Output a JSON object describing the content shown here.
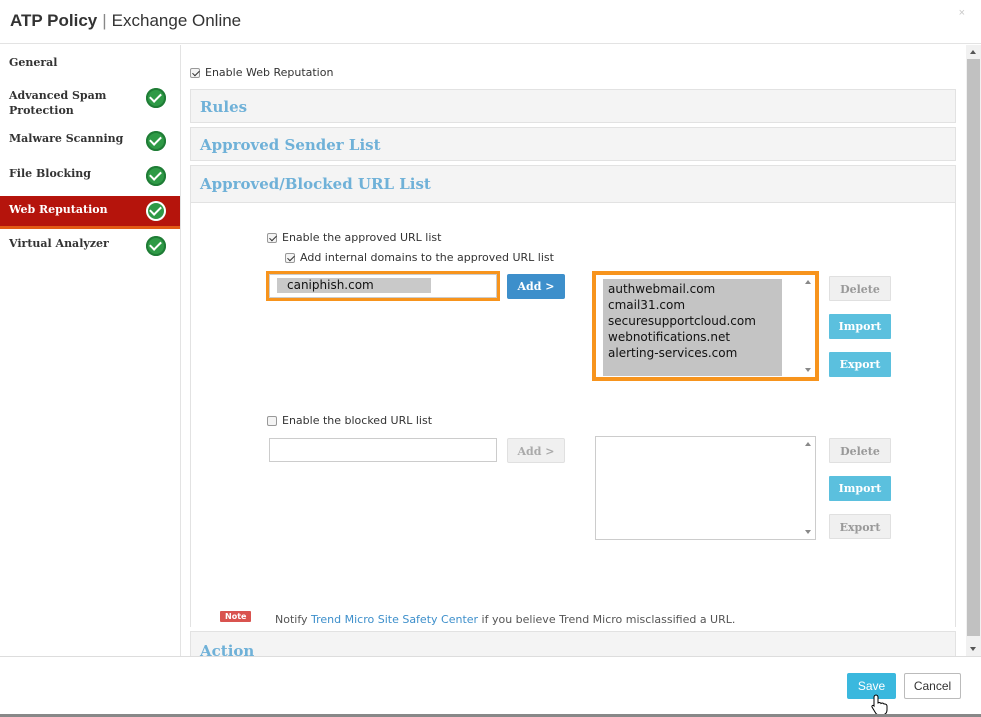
{
  "header": {
    "title_main": "ATP Policy",
    "title_sep": "|",
    "title_sub": "Exchange Online",
    "close_glyph": "×"
  },
  "sidebar": {
    "items": [
      {
        "label": "General",
        "has_check": false
      },
      {
        "label": "Advanced Spam Protection",
        "has_check": true
      },
      {
        "label": "Malware Scanning",
        "has_check": true
      },
      {
        "label": "File Blocking",
        "has_check": true
      },
      {
        "label": "Web Reputation",
        "has_check": true,
        "active": true
      },
      {
        "label": "Virtual Analyzer",
        "has_check": true
      }
    ]
  },
  "main": {
    "enable_web_reputation": {
      "label": "Enable Web Reputation",
      "checked": true
    },
    "sections": {
      "rules": "Rules",
      "approved_sender": "Approved Sender List",
      "url_list": "Approved/Blocked URL List",
      "action": "Action"
    },
    "approved": {
      "enable_label": "Enable the approved URL list",
      "enable_checked": true,
      "internal_label": "Add internal domains to the approved URL list",
      "internal_checked": true,
      "input_value": "caniphish.com",
      "add_label": "Add >",
      "items": [
        "authwebmail.com",
        "cmail31.com",
        "securesupportcloud.com",
        "webnotifications.net",
        "alerting-services.com"
      ],
      "delete_label": "Delete",
      "import_label": "Import",
      "export_label": "Export"
    },
    "blocked": {
      "enable_label": "Enable the blocked URL list",
      "enable_checked": false,
      "input_value": "",
      "add_label": "Add >",
      "delete_label": "Delete",
      "import_label": "Import",
      "export_label": "Export"
    },
    "note": {
      "badge": "Note",
      "prefix": "Notify ",
      "link": "Trend Micro Site Safety Center",
      "suffix": " if you believe Trend Micro misclassified a URL."
    }
  },
  "footer": {
    "save_label": "Save",
    "cancel_label": "Cancel"
  },
  "colors": {
    "accent_blue": "#3d8fcb",
    "section_title": "#6fb1d8",
    "active_nav": "#b5140c",
    "highlight": "#f7941d",
    "check_green": "#2e9a46",
    "save_button": "#3ab8de"
  }
}
